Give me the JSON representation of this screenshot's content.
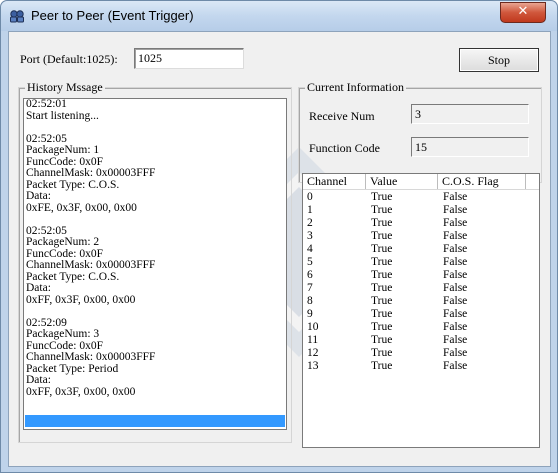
{
  "window": {
    "title": "Peer to Peer (Event Trigger)",
    "close_glyph": "✕"
  },
  "port": {
    "label": "Port (Default:1025):",
    "value": "1025"
  },
  "stop_label": "Stop",
  "history": {
    "legend": "History Mssage",
    "lines": [
      "02:52:01",
      "Start listening...",
      "",
      "02:52:05",
      "PackageNum: 1",
      "FuncCode: 0x0F",
      "ChannelMask: 0x00003FFF",
      "Packet Type: C.O.S.",
      "Data:",
      "0xFE, 0x3F, 0x00, 0x00",
      "",
      "02:52:05",
      "PackageNum: 2",
      "FuncCode: 0x0F",
      "ChannelMask: 0x00003FFF",
      "Packet Type: C.O.S.",
      "Data:",
      "0xFF, 0x3F, 0x00, 0x00",
      "",
      "02:52:09",
      "PackageNum: 3",
      "FuncCode: 0x0F",
      "ChannelMask: 0x00003FFF",
      "Packet Type: Period",
      "Data:",
      "0xFF, 0x3F, 0x00, 0x00"
    ]
  },
  "current": {
    "legend": "Current Information",
    "receive_label": "Receive Num",
    "receive_value": "3",
    "function_label": "Function Code",
    "function_value": "15"
  },
  "table": {
    "headers": [
      "Channel",
      "Value",
      "C.O.S. Flag"
    ],
    "rows": [
      [
        "0",
        "True",
        "False"
      ],
      [
        "1",
        "True",
        "False"
      ],
      [
        "2",
        "True",
        "False"
      ],
      [
        "3",
        "True",
        "False"
      ],
      [
        "4",
        "True",
        "False"
      ],
      [
        "5",
        "True",
        "False"
      ],
      [
        "6",
        "True",
        "False"
      ],
      [
        "7",
        "True",
        "False"
      ],
      [
        "8",
        "True",
        "False"
      ],
      [
        "9",
        "True",
        "False"
      ],
      [
        "10",
        "True",
        "False"
      ],
      [
        "11",
        "True",
        "False"
      ],
      [
        "12",
        "True",
        "False"
      ],
      [
        "13",
        "True",
        "False"
      ]
    ]
  },
  "colors": {
    "selection": "#3399ff",
    "title_bar": "#c3d7ee",
    "close": "#c9452a"
  },
  "icons": {
    "title_icon": "network-peers-icon",
    "close_icon": "close-icon"
  }
}
